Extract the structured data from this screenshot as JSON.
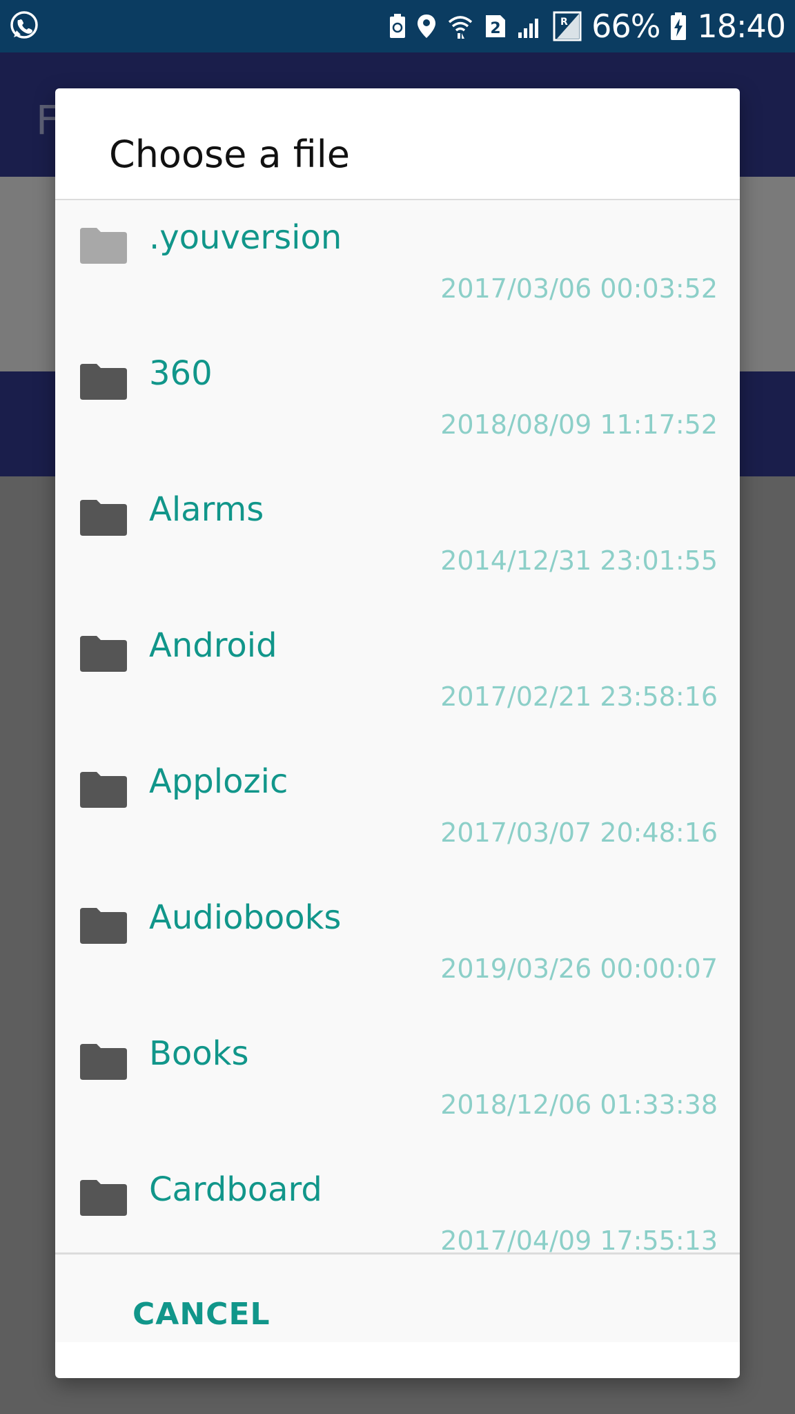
{
  "status_bar": {
    "battery": "66%",
    "time": "18:40",
    "sim_slot": "2",
    "icons": [
      "whatsapp-icon",
      "battery-saver-icon",
      "location-icon",
      "wifi-icon",
      "sim-2-icon",
      "signal-icon",
      "roaming-signal-icon",
      "battery-charging-icon"
    ]
  },
  "background": {
    "appbar_letter": "F"
  },
  "dialog": {
    "title": "Choose a file",
    "cancel_label": "CANCEL",
    "files": [
      {
        "name": ".youversion",
        "date": "2017/03/06 00:03:52",
        "icon": "folder-icon",
        "muted": true
      },
      {
        "name": "360",
        "date": "2018/08/09 11:17:52",
        "icon": "folder-icon",
        "muted": false
      },
      {
        "name": "Alarms",
        "date": "2014/12/31 23:01:55",
        "icon": "folder-icon",
        "muted": false
      },
      {
        "name": "Android",
        "date": "2017/02/21 23:58:16",
        "icon": "folder-icon",
        "muted": false
      },
      {
        "name": "Applozic",
        "date": "2017/03/07 20:48:16",
        "icon": "folder-icon",
        "muted": false
      },
      {
        "name": "Audiobooks",
        "date": "2019/03/26 00:00:07",
        "icon": "folder-icon",
        "muted": false
      },
      {
        "name": "Books",
        "date": "2018/12/06 01:33:38",
        "icon": "folder-icon",
        "muted": false
      },
      {
        "name": "Cardboard",
        "date": "2017/04/09 17:55:13",
        "icon": "folder-icon",
        "muted": false
      }
    ]
  },
  "colors": {
    "status_bar": "#0b3c61",
    "accent": "#11968a",
    "date_text": "#8ccfc8",
    "folder": "#555555",
    "folder_muted": "#a8a8a8",
    "app_primary": "#1a1e4b"
  }
}
